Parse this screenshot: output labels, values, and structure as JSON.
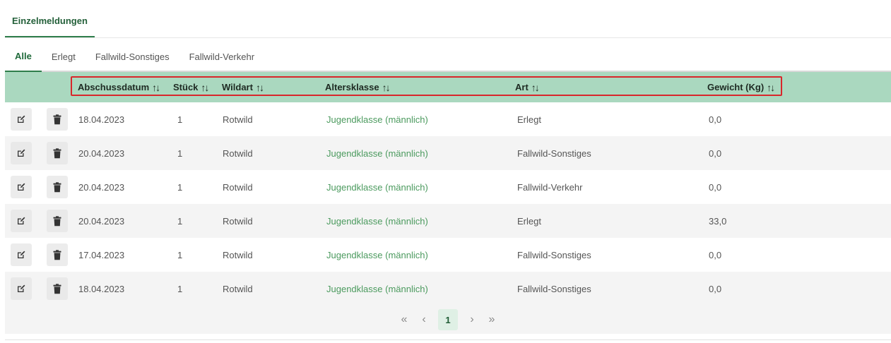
{
  "card": {
    "title": "Einzelmeldungen"
  },
  "tabs": [
    {
      "label": "Alle",
      "active": true
    },
    {
      "label": "Erlegt",
      "active": false
    },
    {
      "label": "Fallwild-Sonstiges",
      "active": false
    },
    {
      "label": "Fallwild-Verkehr",
      "active": false
    }
  ],
  "columns": {
    "abschussdatum": "Abschussdatum",
    "stueck": "Stück",
    "wildart": "Wildart",
    "altersklasse": "Altersklasse",
    "art": "Art",
    "gewicht": "Gewicht (Kg)",
    "sort_glyph": "↑↓"
  },
  "rows": [
    {
      "datum": "18.04.2023",
      "stueck": "1",
      "wildart": "Rotwild",
      "altersklasse": "Jugendklasse (männlich)",
      "art": "Erlegt",
      "gewicht": "0,0"
    },
    {
      "datum": "20.04.2023",
      "stueck": "1",
      "wildart": "Rotwild",
      "altersklasse": "Jugendklasse (männlich)",
      "art": "Fallwild-Sonstiges",
      "gewicht": "0,0"
    },
    {
      "datum": "20.04.2023",
      "stueck": "1",
      "wildart": "Rotwild",
      "altersklasse": "Jugendklasse (männlich)",
      "art": "Fallwild-Verkehr",
      "gewicht": "0,0"
    },
    {
      "datum": "20.04.2023",
      "stueck": "1",
      "wildart": "Rotwild",
      "altersklasse": "Jugendklasse (männlich)",
      "art": "Erlegt",
      "gewicht": "33,0"
    },
    {
      "datum": "17.04.2023",
      "stueck": "1",
      "wildart": "Rotwild",
      "altersklasse": "Jugendklasse (männlich)",
      "art": "Fallwild-Sonstiges",
      "gewicht": "0,0"
    },
    {
      "datum": "18.04.2023",
      "stueck": "1",
      "wildart": "Rotwild",
      "altersklasse": "Jugendklasse (männlich)",
      "art": "Fallwild-Sonstiges",
      "gewicht": "0,0"
    }
  ],
  "pagination": {
    "first": "«",
    "prev": "‹",
    "current": "1",
    "next": "›",
    "last": "»"
  },
  "icons": {
    "edit": "edit-icon",
    "delete": "trash-icon"
  },
  "colors": {
    "accent": "#2f7d4b",
    "header_bg": "#aad8bf",
    "highlight_border": "#d9262b",
    "link_green": "#4b9a5e"
  }
}
